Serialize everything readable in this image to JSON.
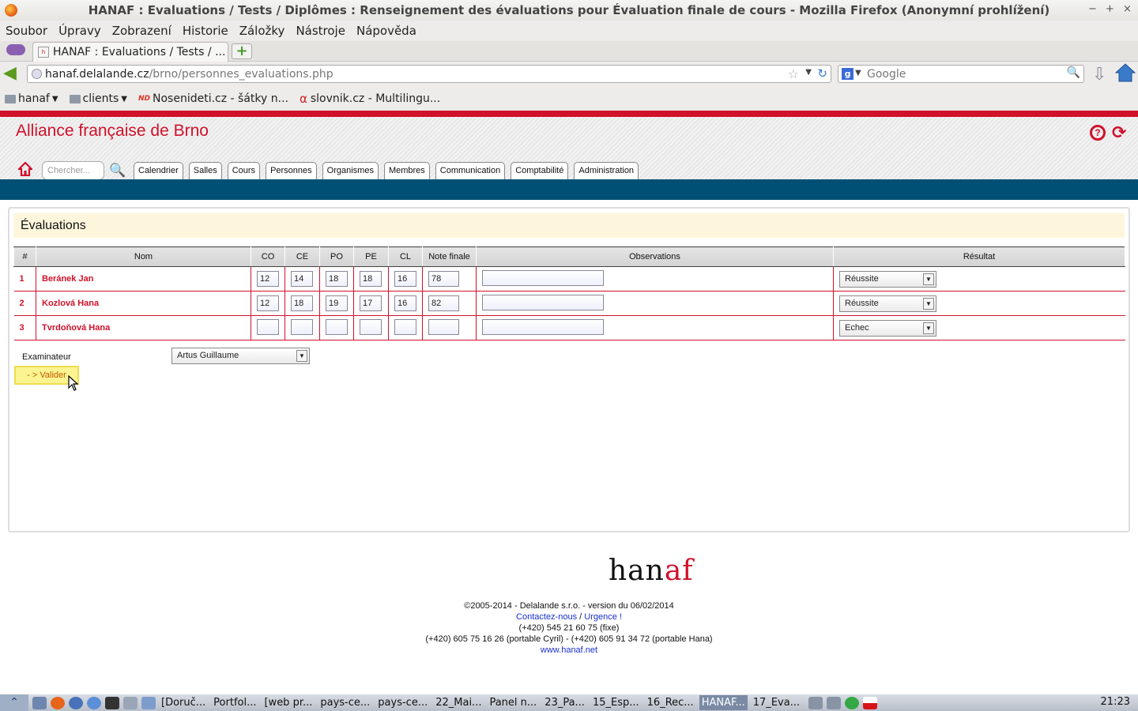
{
  "window": {
    "title": "HANAF : Evaluations / Tests / Diplômes : Renseignement des évaluations pour Évaluation finale de cours - Mozilla Firefox (Anonymní prohlížení)",
    "controls": [
      "−",
      "+",
      "×"
    ]
  },
  "menu": [
    "Soubor",
    "Úpravy",
    "Zobrazení",
    "Historie",
    "Záložky",
    "Nástroje",
    "Nápověda"
  ],
  "tab": {
    "title": "HANAF : Evaluations / Tests / ...",
    "new_tab": "+"
  },
  "url": {
    "host": "hanaf.delalande.cz",
    "path": "/brno/personnes_evaluations.php",
    "prefix": "hanaf."
  },
  "search": {
    "placeholder": "Google"
  },
  "bookmarks": [
    {
      "label": "hanaf"
    },
    {
      "label": "clients"
    },
    {
      "label": "Nosenideti.cz - šátky n..."
    },
    {
      "label": "slovnik.cz - Multilingu..."
    }
  ],
  "site": {
    "title": "Alliance française de Brno",
    "search_placeholder": "Chercher...",
    "nav": [
      "Calendrier",
      "Salles",
      "Cours",
      "Personnes",
      "Organismes",
      "Membres",
      "Communication",
      "Comptabilité",
      "Administration"
    ]
  },
  "evaluations": {
    "heading": "Évaluations",
    "columns": [
      "#",
      "Nom",
      "CO",
      "CE",
      "PO",
      "PE",
      "CL",
      "Note finale",
      "Observations",
      "Résultat"
    ],
    "rows": [
      {
        "num": "1",
        "name": "Beránek Jan",
        "co": "12",
        "ce": "14",
        "po": "18",
        "pe": "18",
        "cl": "16",
        "final": "78",
        "result": "Réussite"
      },
      {
        "num": "2",
        "name": "Kozlová Hana",
        "co": "12",
        "ce": "18",
        "po": "19",
        "pe": "17",
        "cl": "16",
        "final": "82",
        "result": "Réussite"
      },
      {
        "num": "3",
        "name": "Tvrdoňová Hana",
        "co": "",
        "ce": "",
        "po": "",
        "pe": "",
        "cl": "",
        "final": "",
        "result": "Echec"
      }
    ],
    "examiner_label": "Examinateur",
    "examiner_value": "Artus Guillaume",
    "submit_label": "- > Valider"
  },
  "footer": {
    "logo_a": "han",
    "logo_b": "af",
    "copyright": "©2005-2014 - Delalande s.r.o. - version du 06/02/2014",
    "contact": "Contactez-nous",
    "separator": " / ",
    "urgence": "Urgence !",
    "phone_fixed": "(+420) 545 21 60 75 (fixe)",
    "phones_mobile": "(+420) 605 75 16 26 (portable Cyril) - (+420) 605 91 34 72 (portable Hana)",
    "site_link": "www.hanaf.net"
  },
  "taskbar": {
    "tasks": [
      "[Doruč...",
      "Portfol...",
      "[web pr...",
      "pays-ce...",
      "pays-ce...",
      "22_Mai...",
      "Panel n...",
      "23_Pa...",
      "15_Esp...",
      "16_Rec...",
      "HANAF...",
      "17_Eva..."
    ],
    "clock": "21:23"
  },
  "colors": {
    "brand_red": "#d0112b",
    "blue_bar": "#005075",
    "panel_head": "#fdf6dc"
  }
}
